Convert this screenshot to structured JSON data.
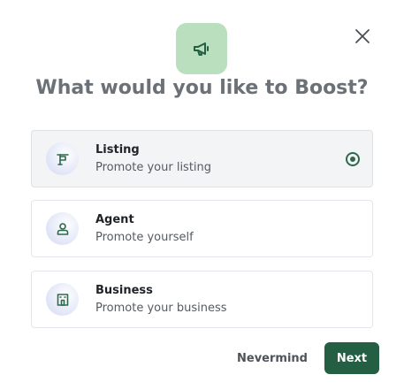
{
  "dialog": {
    "title": "What would you like to Boost?",
    "hero_icon": "megaphone-icon",
    "close_icon": "close-icon"
  },
  "options": [
    {
      "id": "listing",
      "label": "Listing",
      "description": "Promote your listing",
      "icon": "flag-icon",
      "selected": true
    },
    {
      "id": "agent",
      "label": "Agent",
      "description": "Promote yourself",
      "icon": "person-icon",
      "selected": false
    },
    {
      "id": "business",
      "label": "Business",
      "description": "Promote your business",
      "icon": "building-icon",
      "selected": false
    }
  ],
  "footer": {
    "cancel_label": "Nevermind",
    "next_label": "Next"
  },
  "colors": {
    "accent": "#245f43",
    "hero_bg": "#b9dfbe",
    "icon_stroke": "#2e6a4a"
  }
}
